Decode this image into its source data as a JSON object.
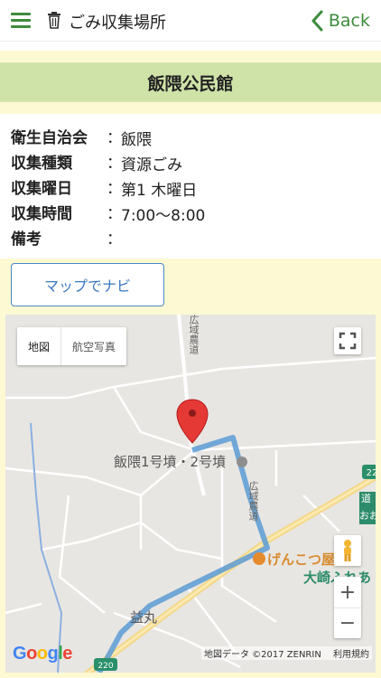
{
  "header": {
    "title": "ごみ収集場所",
    "back_label": "Back",
    "accent_color": "#3d8b3d",
    "icons": [
      "hamburger-menu-icon",
      "trash-icon",
      "chevron-left-icon"
    ]
  },
  "place": {
    "name": "飯隈公民館"
  },
  "info": {
    "rows": [
      {
        "label": "衛生自治会",
        "value": "飯隈"
      },
      {
        "label": "収集種類",
        "value": "資源ごみ"
      },
      {
        "label": "収集曜日",
        "value": "第1 木曜日"
      },
      {
        "label": "収集時間",
        "value": "7:00〜8:00"
      },
      {
        "label": "備考",
        "value": ""
      }
    ],
    "separator": "："
  },
  "nav_button": {
    "label": "マップでナビ"
  },
  "map": {
    "type_options": [
      "地図",
      "航空写真"
    ],
    "selected_type": "地図",
    "labels": {
      "landmark": "飯隈1号墳・2号墳",
      "restaurant": "げんこつ屋",
      "area": "大崎ふれあ",
      "village": "益丸",
      "road_badge_1": "220",
      "road_badge_2": "22",
      "right_edge_1": "道",
      "right_edge_2": "おお",
      "road_name_1": "広域農道",
      "road_name_2": "広域農道"
    },
    "zoom_in": "+",
    "zoom_out": "−",
    "attribution": "地図データ ©2017 ZENRIN",
    "terms": "利用規約",
    "logo": "Google",
    "route_color": "#5b9bd5",
    "marker_color": "#e53935"
  }
}
